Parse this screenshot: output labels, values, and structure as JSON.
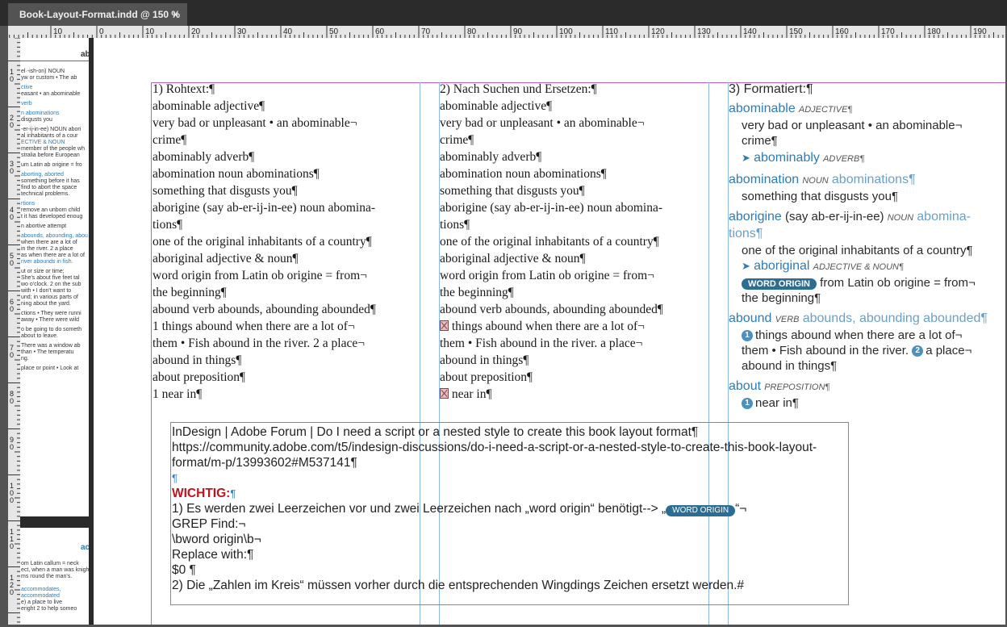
{
  "tab": {
    "title": "Book-Layout-Format.indd @ 150 %",
    "close_icon": "×"
  },
  "ruler": {
    "ticks": [
      "10",
      "0",
      "10",
      "20",
      "30",
      "40",
      "50",
      "60",
      "70",
      "80",
      "90",
      "100",
      "110",
      "120",
      "130",
      "140",
      "150",
      "160",
      "170",
      "180",
      "190"
    ]
  },
  "vruler": {
    "ticks": [
      "1 0",
      "2 0",
      "3 0",
      "4 0",
      "5 0",
      "6 0",
      "7 0",
      "8 0",
      "9 0",
      "1 0 0",
      "1 1 0",
      "1 2 0"
    ]
  },
  "thumb": {
    "header1": "ab",
    "lines": [
      "el·-ish-on) NOUN",
      "yw or custom • The ab",
      "",
      "ctive",
      "easant • an abominable",
      "",
      "verb",
      "",
      "n abominations",
      "disgusts you",
      "",
      "-er-ij-in-ee) NOUN abori",
      "al inhabitants of a cour",
      "ECTIVE & NOUN",
      "member of the people wh",
      "stralia before European",
      "",
      "um Latin ab origine = fro",
      "",
      "aborting, aborted",
      "something before it has",
      "find to abort the space",
      "technical problems.",
      "",
      "rtions",
      "remove an unborn child",
      "t it has developed enoug",
      "",
      "n abortive attempt",
      "",
      "abounds, abounding, abou",
      "when there are a lot of",
      "in the river. 2 a place",
      "as when there are a lot of",
      "river abounds in fish.",
      "",
      "ut or size or time;",
      "She's about five feet tal",
      "wo o'clock. 2 on the sub",
      "with • I don't want to",
      "und; in various parts of",
      "ning about the yard.",
      "",
      "ctions • They were runni",
      "away • There were wild",
      "",
      "o be going to do someth",
      "about to leave.",
      "",
      "There was a window ab",
      "than • The temperatu",
      "ng.",
      "",
      "place or point • Look at"
    ],
    "header2": "acc",
    "lines2": [
      "om Latin callum = neck",
      "ect, when a man was knigh",
      "ms round the man's.",
      "",
      "",
      "accommodates,",
      "accommodated",
      "e) a place to live",
      "eright 2 to help someo"
    ]
  },
  "col1": {
    "lines": [
      "1) Rohtext:¶",
      "abominable adjective¶",
      "very bad or unpleasant • an abominable¬",
      "crime¶",
      "abominably adverb¶",
      "abomination noun abominations¶",
      "something that disgusts you¶",
      "aborigine (say ab-er-ij-in-ee) noun abomina-",
      "tions¶",
      "one of the original inhabitants of a country¶",
      "aboriginal adjective & noun¶",
      "word origin from Latin ob origine = from¬",
      "the beginning¶",
      "abound verb abounds, abounding abounded¶",
      "1 things abound when there are a lot of¬",
      "them • Fish abound in the river. 2 a place¬",
      "abound in things¶",
      "about preposition¶",
      "1 near in¶"
    ]
  },
  "col2": {
    "lines": [
      "2) Nach Suchen und Ersetzen:¶",
      "abominable adjective¶",
      "very bad or unpleasant • an abominable¬",
      "crime¶",
      "abominably adverb¶",
      "abomination noun abominations¶",
      "something that disgusts you¶",
      "aborigine (say ab-er-ij-in-ee) noun abomina-",
      "tions¶",
      "one of the original inhabitants of a country¶",
      "aboriginal adjective & noun¶",
      "  word origin   from Latin ob origine = from¬",
      "the beginning¶",
      "abound verb abounds, abounding abounded¶",
      " things abound when there are a lot of¬",
      "them • Fish abound in the river.  a place¬",
      "abound in things¶",
      "about preposition¶",
      " near in¶"
    ]
  },
  "col3": {
    "title": "3) Formatiert:¶",
    "e1_hw": "abominable",
    "e1_pos": "ADJECTIVE¶",
    "e1_l1": "very bad or unpleasant • an abominable¬",
    "e1_l2": "crime¶",
    "e1_sub_arrow": "➤",
    "e1_sub": "abominably",
    "e1_sub_pos": "ADVERB¶",
    "e2_hw": "abomination",
    "e2_pos": "NOUN",
    "e2_pl": "abominations¶",
    "e2_l1": "something that disgusts you¶",
    "e3_hw": "aborigine",
    "e3_say": "(say ab-er-ij-in-ee)",
    "e3_pos": "NOUN",
    "e3_pl": "abomina-",
    "e3_pl2": "tions¶",
    "e3_l1": "one of the original inhabitants of a country¶",
    "e3_sub_arrow": "➤",
    "e3_sub": "aboriginal",
    "e3_sub_pos": "ADJECTIVE & NOUN¶",
    "e3_badge": "WORD ORIGIN",
    "e3_orig": "from Latin ob origine = from¬",
    "e3_orig2": "the beginning¶",
    "e4_hw": "abound",
    "e4_pos": "VERB",
    "e4_forms": "abounds, abounding abounded¶",
    "e4_n1": "1",
    "e4_l1": "things abound when there are a lot of¬",
    "e4_l2a": "them • Fish abound in the river.",
    "e4_n2": "2",
    "e4_l2b": "a place¬",
    "e4_l3": "abound in things¶",
    "e5_hw": "about",
    "e5_pos": "PREPOSITION¶",
    "e5_n1": "1",
    "e5_l1": "near in¶"
  },
  "note": {
    "l1": "InDesign | Adobe Forum | Do I need a script or a nested style to create this book layout format¶",
    "l2": "https://community.adobe.com/t5/indesign-discussions/do-i-need-a-script-or-a-nested-style-to-create-this-book-layout-",
    "l3": "format/m-p/13993602#M537141¶",
    "l4": "¶",
    "wichtig": "WICHTIG:",
    "wichtig_pm": "¶",
    "l6a": "1) Es werden zwei Leerzeichen vor und zwei Leerzeichen nach „word origin“ benötigt--> „",
    "l6_badge": "WORD ORIGIN",
    "l6b": "“¬",
    "l7": "GREP Find:¬",
    "l8": "\\bword origin\\b¬",
    "l9": "Replace with:¶",
    "l10": "  $0  ¶",
    "l11": "2) Die „Zahlen im Kreis“ müssen vorher durch die entsprechenden Wingdings Zeichen ersetzt werden.#"
  },
  "colors": {
    "accent": "#2f7bb5",
    "frame": "#c25bd1",
    "guide": "#5b94c9",
    "alert": "#c0141c"
  }
}
